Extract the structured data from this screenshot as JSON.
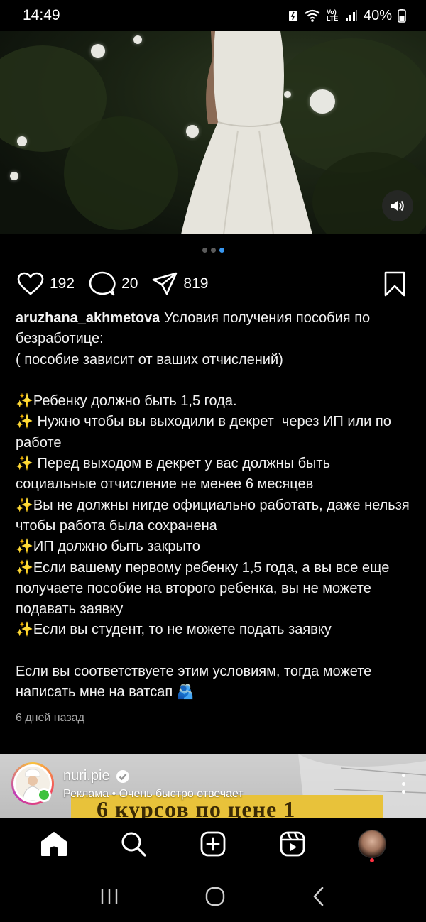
{
  "status_bar": {
    "time": "14:49",
    "network": "Vo) LTE",
    "battery": "40%"
  },
  "post": {
    "carousel": {
      "total": 3,
      "active": 3
    },
    "likes": "192",
    "comments": "20",
    "shares": "819",
    "username": "aruzhana_akhmetova",
    "caption_text": " Условия получения пособия по безработице:\n( пособие зависит от ваших отчислений)\n\n✨Ребенку должно быть 1,5 года.\n✨ Нужно чтобы вы выходили в декрет  через ИП или по работе\n✨ Перед выходом в декрет у вас должны быть социальные отчисление не менее 6 месяцев\n✨Вы не должны нигде официально работать, даже нельзя чтобы работа была сохранена\n✨ИП должно быть закрыто\n✨Если вашему первому ребенку 1,5 года, а вы все еще получаете пособие на второго ребенка, вы не можете подавать заявку\n✨Если вы студент, то не можете подать заявку\n\nЕсли вы соответствуете этим условиям, тогда можете написать мне на ватсап 🫂",
    "timestamp": "6 дней назад"
  },
  "ad": {
    "account": "nuri.pie",
    "subtitle": "Реклама • Очень быстро отвечает",
    "banner_text": "6 курсов по цене 1"
  },
  "colors": {
    "background": "#000000",
    "accent_blue": "#3897f0",
    "online_green": "#3ec23e",
    "notification_red": "#ff3040"
  },
  "icons": {
    "actions": [
      "heart-icon",
      "comment-icon",
      "share-icon",
      "bookmark-icon"
    ],
    "tabs": [
      "home-icon",
      "search-icon",
      "create-icon",
      "reels-icon",
      "profile-avatar"
    ],
    "system": [
      "recents-icon",
      "home-circle-icon",
      "back-icon"
    ]
  }
}
